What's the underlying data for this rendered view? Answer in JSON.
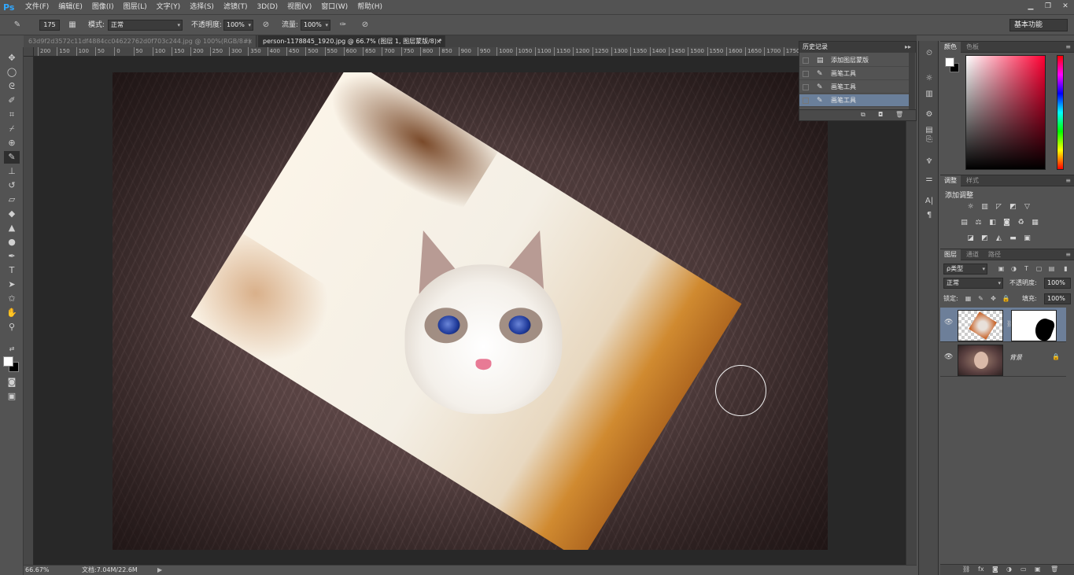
{
  "app": {
    "logo": "Ps"
  },
  "menu": [
    "文件(F)",
    "编辑(E)",
    "图像(I)",
    "图层(L)",
    "文字(Y)",
    "选择(S)",
    "滤镜(T)",
    "3D(D)",
    "视图(V)",
    "窗口(W)",
    "帮助(H)"
  ],
  "window_controls": {
    "minimize": "▁",
    "restore": "❐",
    "close": "✕"
  },
  "options": {
    "brush_size": "175",
    "mode_label": "模式:",
    "mode_value": "正常",
    "opacity_label": "不透明度:",
    "opacity_value": "100%",
    "flow_label": "流量:",
    "flow_value": "100%",
    "workspace": "基本功能"
  },
  "tabs": [
    {
      "label": "63d9f2d3572c11df4884cc04622762d0f703c244.jpg @ 100%(RGB/8#)",
      "close": "×",
      "active": false
    },
    {
      "label": "person-1178845_1920.jpg @ 66.7% (图层 1, 图层蒙版/8) *",
      "close": "×",
      "active": true
    }
  ],
  "ruler_ticks": [
    "200",
    "150",
    "100",
    "50",
    "0",
    "50",
    "100",
    "150",
    "200",
    "250",
    "300",
    "350",
    "400",
    "450",
    "500",
    "550",
    "600",
    "650",
    "700",
    "750",
    "800",
    "850",
    "900",
    "950",
    "1000",
    "1050",
    "1100",
    "1150",
    "1200",
    "1250",
    "1300",
    "1350",
    "1400",
    "1450",
    "1500",
    "1550",
    "1600",
    "1650",
    "1700",
    "1750",
    "1800"
  ],
  "status": {
    "zoom": "66.67%",
    "doc": "文档:7.04M/22.6M",
    "play": "▶"
  },
  "history": {
    "title": "历史记录",
    "expand": "▸▸",
    "items": [
      {
        "label": "添加图层蒙版",
        "icon": "mask-icon",
        "selected": false
      },
      {
        "label": "画笔工具",
        "icon": "brush-icon",
        "selected": false
      },
      {
        "label": "画笔工具",
        "icon": "brush-icon",
        "selected": false
      },
      {
        "label": "画笔工具",
        "icon": "brush-icon",
        "selected": true
      }
    ]
  },
  "color_panel": {
    "tabs": [
      "颜色",
      "色板"
    ],
    "menu": "≡"
  },
  "adjust_panel": {
    "tabs": [
      "调整",
      "样式"
    ],
    "title": "添加调整",
    "menu": "≡"
  },
  "layers_panel": {
    "tabs": [
      "图层",
      "通道",
      "路径"
    ],
    "menu": "≡",
    "filter_value": "ρ类型",
    "blend_mode": "正常",
    "opacity_label": "不透明度:",
    "opacity_value": "100%",
    "lock_label": "锁定:",
    "fill_label": "填充:",
    "fill_value": "100%",
    "layers": [
      {
        "name": "",
        "has_mask": true,
        "selected": true
      },
      {
        "name": "背景",
        "locked": true,
        "selected": false
      }
    ]
  }
}
